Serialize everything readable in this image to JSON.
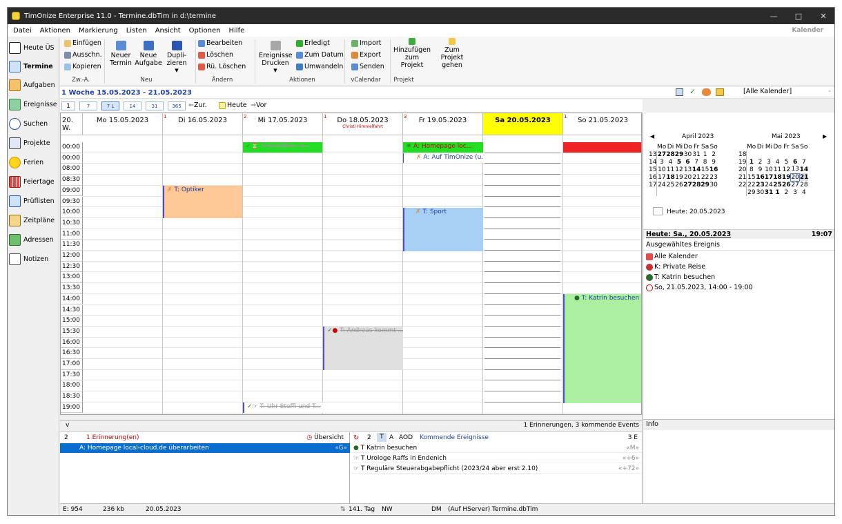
{
  "window": {
    "title": "TimOnize Enterprise 11.0 - Termine.dbTim in d:\\termine"
  },
  "menu": {
    "items": [
      "Datei",
      "Aktionen",
      "Markierung",
      "Listen",
      "Ansicht",
      "Optionen",
      "Hilfe"
    ],
    "right_label": "Kalender"
  },
  "sidebar": {
    "items": [
      {
        "label": "Heute ÜS",
        "icon": "calendar-23-icon"
      },
      {
        "label": "Termine",
        "icon": "calendar-grid-icon"
      },
      {
        "label": "Aufgaben",
        "icon": "task-check-icon"
      },
      {
        "label": "Ereignisse",
        "icon": "events-icon"
      },
      {
        "label": "Suchen",
        "icon": "search-icon"
      },
      {
        "label": "Projekte",
        "icon": "project-icon"
      },
      {
        "label": "Ferien",
        "icon": "sun-icon"
      },
      {
        "label": "Feiertage",
        "icon": "holiday-grid-icon"
      },
      {
        "label": "Prüflisten",
        "icon": "checklist-icon"
      },
      {
        "label": "Zeitpläne",
        "icon": "schedule-icon"
      },
      {
        "label": "Adressen",
        "icon": "address-book-icon"
      },
      {
        "label": "Notizen",
        "icon": "note-icon"
      }
    ]
  },
  "ribbon": {
    "clipboard": {
      "paste": "Einfügen",
      "cut": "Ausschn.",
      "copy": "Kopieren",
      "group": "Zw.-A."
    },
    "new": {
      "termin_1": "Neuer",
      "termin_2": "Termin",
      "aufgabe_1": "Neue",
      "aufgabe_2": "Aufgabe",
      "dup_1": "Dupli-",
      "dup_2": "zieren",
      "group": "Neu"
    },
    "change": {
      "edit": "Bearbeiten",
      "delete": "Löschen",
      "undelete": "Rü. Löschen",
      "group": "Ändern"
    },
    "actions": {
      "print_1": "Ereignisse",
      "print_2": "Drucken",
      "done": "Erledigt",
      "to_date": "Zum Datum",
      "convert": "Umwandeln",
      "group": "Aktionen"
    },
    "vcal": {
      "import": "Import",
      "export": "Export",
      "send": "Senden",
      "group": "vCalendar"
    },
    "project": {
      "add_1": "Hinzufügen",
      "add_2": "zum",
      "add_3": "Projekt",
      "goto_1": "Zum Projekt",
      "goto_2": "gehen",
      "group": "Projekt"
    }
  },
  "weekbar": {
    "range": "1 Woche  15.05.2023 - 21.05.2023",
    "calendar_select": "[Alle Kalender]"
  },
  "viewbar": {
    "views": [
      "1",
      "7",
      "7 L",
      "14",
      "31",
      "365"
    ],
    "back": "Zur.",
    "today": "Heute",
    "forward": "Vor"
  },
  "calendar": {
    "week_label": "20. W.",
    "days": [
      {
        "label": "Mo  15.05.2023",
        "sub": ""
      },
      {
        "label": "Di  16.05.2023",
        "sub": ""
      },
      {
        "label": "Mi  17.05.2023",
        "sub": ""
      },
      {
        "label": "Do  18.05.2023",
        "sub": "Christi Himmelfahrt"
      },
      {
        "label": "Fr  19.05.2023",
        "sub": ""
      },
      {
        "label": "Sa  20.05.2023",
        "sub": ""
      },
      {
        "label": "So  21.05.2023",
        "sub": ""
      }
    ],
    "day_marks": [
      "1",
      "2",
      "1",
      "3",
      "1"
    ],
    "times": [
      "00:00",
      "00:00",
      "08:00",
      "08:30",
      "09:00",
      "09:30",
      "10:00",
      "10:30",
      "11:00",
      "11:30",
      "12:00",
      "12:30",
      "13:00",
      "13:30",
      "14:00",
      "14:30",
      "15:00",
      "15:30",
      "16:00",
      "16:30",
      "17:00",
      "17:30",
      "18:00",
      "18:30",
      "19:00"
    ],
    "events": {
      "optiker": "T: Optiker",
      "schaeffler": "T: Schäffler, U...",
      "homepage": "A: Homepage loc...",
      "timonize": "A: Auf TimOnize (u...",
      "sport": "T: Sport",
      "katrin": "T: Katrin besuchen",
      "andreas": "T: Andreas kommt ...",
      "uhr": "T: Uhr Steffi und T..."
    }
  },
  "colors": {
    "today_header": "#ffff00",
    "optiker": "#fdc896",
    "sport": "#a8cff4",
    "katrin": "#aaf0a0",
    "homepage": "#22dd22",
    "red_block": "#ee2222",
    "andreas": "#e0e0e0",
    "selection": "#0a6ecf"
  },
  "minical": {
    "april_title": "April 2023",
    "may_title": "Mai 2023",
    "weekdays": [
      "Mo",
      "Di",
      "Mi",
      "Do",
      "Fr",
      "Sa",
      "So"
    ],
    "april_rows": [
      [
        "13",
        "27",
        "28",
        "29",
        "30",
        "31",
        "1",
        "2"
      ],
      [
        "14",
        "3",
        "4",
        "5",
        "6",
        "7",
        "8",
        "9"
      ],
      [
        "15",
        "10",
        "11",
        "12",
        "13",
        "14",
        "15",
        "16"
      ],
      [
        "16",
        "17",
        "18",
        "19",
        "20",
        "21",
        "22",
        "23"
      ],
      [
        "17",
        "24",
        "25",
        "26",
        "27",
        "28",
        "29",
        "30"
      ],
      [
        "",
        "",
        "",
        "",
        "",
        "",
        "",
        ""
      ]
    ],
    "may_rows": [
      [
        "18",
        "",
        "",
        "",
        "",
        "",
        "",
        ""
      ],
      [
        "19",
        "1",
        "2",
        "3",
        "4",
        "5",
        "6",
        "7"
      ],
      [
        "20",
        "8",
        "9",
        "10",
        "11",
        "12",
        "13",
        "14"
      ],
      [
        "21",
        "15",
        "16",
        "17",
        "18",
        "19",
        "20",
        "21"
      ],
      [
        "22",
        "22",
        "23",
        "24",
        "25",
        "26",
        "27",
        "28"
      ],
      [
        "",
        "29",
        "30",
        "31",
        "1",
        "2",
        "3",
        "4"
      ]
    ],
    "today_label": "Heute: 20.05.2023"
  },
  "right": {
    "today_line": "Heute: Sa., 20.05.2023",
    "time": "19:07",
    "selected_title": "Ausgewähltes Ereignis",
    "selected": [
      "Alle Kalender",
      "K: Private Reise",
      "T: Katrin besuchen",
      "So, 21.05.2023, 14:00 - 19:00"
    ],
    "info": "Info"
  },
  "bottom": {
    "collapse": "v",
    "summary": "1 Erinnerungen, 3 kommende Events",
    "rem_count": "2",
    "rem_label": "1 Erinnerung(en)",
    "overview": "Übersicht",
    "rem_item": "A: Homepage local-cloud.de überarbeiten",
    "rem_item_tag": "«G»",
    "upcoming_count": "2",
    "upcoming_tabs": [
      "T",
      "A",
      "AOD"
    ],
    "upcoming_label": "Kommende Ereignisse",
    "upcoming_total": "3 E",
    "upcoming": [
      {
        "text": "T Katrin besuchen",
        "tag": "«M»"
      },
      {
        "text": "T Urologe Raffs in Endenich",
        "tag": "«+6»"
      },
      {
        "text": "T Reguläre Steuerabgabepflicht (2023/24 aber erst 2.10)",
        "tag": "«+72»"
      }
    ]
  },
  "status": {
    "entries": "E: 954",
    "size": "236 kb",
    "date": "20.05.2023",
    "day": "141. Tag",
    "nw": "NW",
    "dm": "DM",
    "db": "(Auf HServer) Termine.dbTim"
  }
}
